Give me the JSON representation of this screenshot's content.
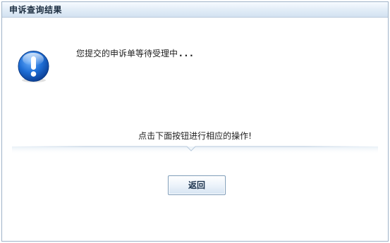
{
  "window": {
    "title": "申诉查询结果"
  },
  "content": {
    "icon": "exclamation-info-icon",
    "message": "您提交的申诉单等待受理中",
    "message_dots": "...",
    "hint": "点击下面按钮进行相应的操作!"
  },
  "actions": {
    "back_label": "返回"
  },
  "colors": {
    "icon_blue": "#1a63c6",
    "title_bar_top": "#f7fbff",
    "title_bar_bottom": "#d3e2f1",
    "border": "#9fb3c8"
  }
}
